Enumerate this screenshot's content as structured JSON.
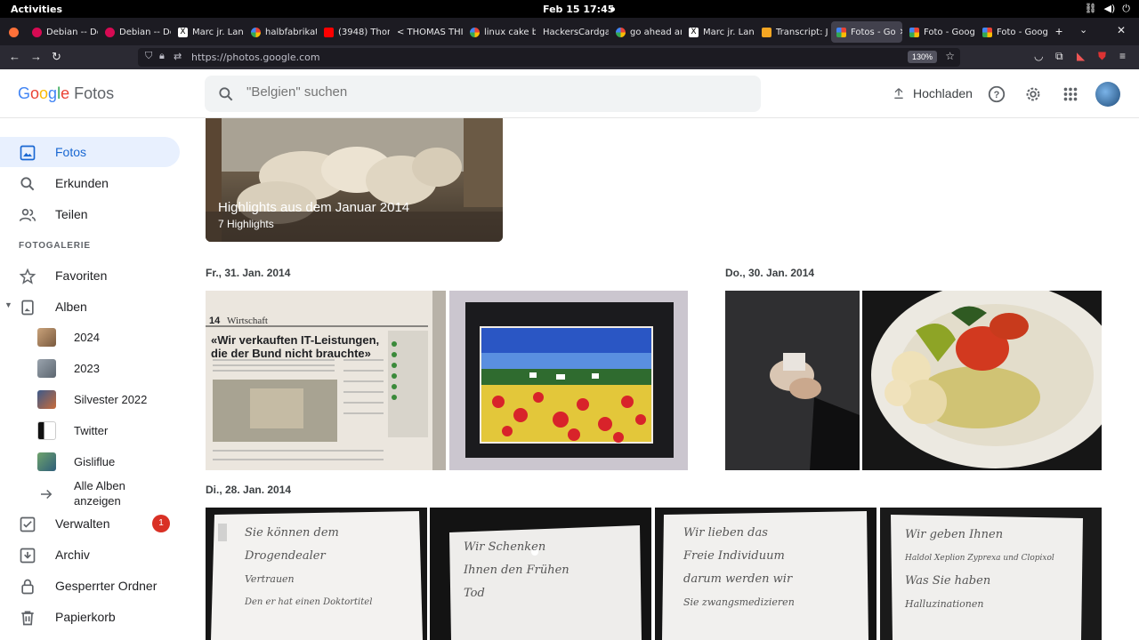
{
  "system_bar": {
    "activities": "Activities",
    "clock": "Feb 15  17:45"
  },
  "browser": {
    "tabs": [
      {
        "label": "Debian -- De"
      },
      {
        "label": "Debian -- De"
      },
      {
        "label": "Marc jr. Lan"
      },
      {
        "label": "halbfabrikat"
      },
      {
        "label": "(3948) Thom"
      },
      {
        "label": "< THOMAS THI"
      },
      {
        "label": "linux cake bi"
      },
      {
        "label": "HackersCardga"
      },
      {
        "label": "go ahead an"
      },
      {
        "label": "Marc jr. Lan"
      },
      {
        "label": "Transcript: J"
      },
      {
        "label": "Fotos - Go"
      },
      {
        "label": "Foto - Goog"
      },
      {
        "label": "Foto - Goog"
      }
    ],
    "new_tab": "+",
    "url": "https://photos.google.com",
    "zoom": "130%"
  },
  "header": {
    "logo": {
      "G": "G",
      "o1": "o",
      "o2": "o",
      "g": "g",
      "l": "l",
      "e": "e",
      "fotos": "Fotos"
    },
    "search_placeholder": "\"Belgien\" suchen",
    "upload_label": "Hochladen"
  },
  "sidebar": {
    "items": [
      {
        "label": "Fotos",
        "icon": "photo-icon"
      },
      {
        "label": "Erkunden",
        "icon": "search-icon"
      },
      {
        "label": "Teilen",
        "icon": "people-icon"
      }
    ],
    "section_label": "FOTOGALERIE",
    "library": [
      {
        "label": "Favoriten",
        "icon": "star-icon"
      },
      {
        "label": "Alben",
        "icon": "album-icon"
      }
    ],
    "albums": [
      {
        "label": "2024"
      },
      {
        "label": "2023"
      },
      {
        "label": "Silvester 2022"
      },
      {
        "label": "Twitter"
      },
      {
        "label": "Gisliflue"
      }
    ],
    "all_albums": "Alle Alben anzeigen",
    "tools": [
      {
        "label": "Verwalten",
        "icon": "checklist-icon",
        "badge": "1"
      },
      {
        "label": "Archiv",
        "icon": "archive-icon"
      },
      {
        "label": "Gesperrter Ordner",
        "icon": "lock-icon"
      },
      {
        "label": "Papierkorb",
        "icon": "trash-icon"
      }
    ]
  },
  "main": {
    "highlight": {
      "title": "Highlights aus dem Januar 2014",
      "subtitle": "7 Highlights"
    },
    "dates": [
      "Fr., 31. Jan. 2014",
      "Do., 30. Jan. 2014",
      "Di., 28. Jan. 2014"
    ],
    "newspaper": {
      "section": "Wirtschaft",
      "page": "14",
      "headline_1": "«Wir verkauften IT-Leistungen,",
      "headline_2": "die der Bund nicht brauchte»"
    },
    "notes": [
      {
        "lines": [
          "Sie können dem",
          "Drogendealer",
          "Vertrauen",
          "Den er hat einen Doktortitel"
        ]
      },
      {
        "lines": [
          "Wir Schenken",
          "Ihnen den Frühen",
          "Tod"
        ]
      },
      {
        "lines": [
          "Wir lieben das",
          "Freie Individuum",
          "darum werden wir",
          "Sie zwangsmedizieren"
        ]
      },
      {
        "lines": [
          "Wir geben Ihnen",
          "Haldol Xeplion Zyprexa und Clopixol",
          "Was Sie haben",
          "Halluzinationen"
        ]
      }
    ]
  }
}
